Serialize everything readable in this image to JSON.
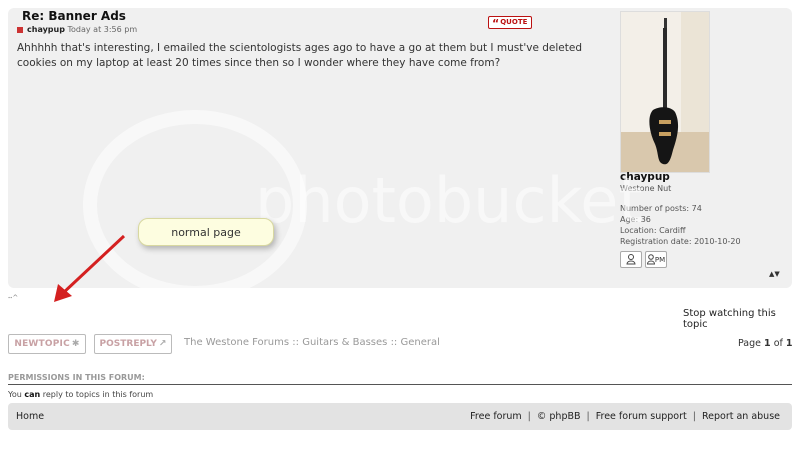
{
  "post": {
    "title": "Re: Banner Ads",
    "author": "chaypup",
    "time": "Today at 3:56 pm",
    "quote_label": "QUOTE",
    "body": "Ahhhhh that's interesting, I emailed the scientologists ages ago to have a go at them but I must've deleted cookies on my laptop at least 20 times since then so I wonder where they have come from?"
  },
  "profile": {
    "name": "chaypup",
    "rank": "Westone Nut",
    "posts": "Number of posts: 74",
    "age": "Age: 36",
    "location": "Location: Cardiff",
    "registered": "Registration date: 2010-10-20",
    "pm_label": "PM",
    "avatar_icon": "bass-guitar-photo"
  },
  "topic": {
    "stop_watching": "Stop watching this topic",
    "new_topic": "NEWTOPIC",
    "post_reply": "POSTREPLY",
    "crumb_1": "The Westone Forums",
    "crumb_2": "Guitars & Basses",
    "crumb_3": "General",
    "crumb_sep": "::",
    "page_prefix": "Page",
    "page_current": "1",
    "page_of": "of",
    "page_total": "1"
  },
  "permissions": {
    "title": "PERMISSIONS IN THIS FORUM:",
    "text_before": "You",
    "text_bold": "can",
    "text_after": "reply to topics in this forum"
  },
  "footer": {
    "home": "Home",
    "free_forum": "Free forum",
    "copyright": "©",
    "phpbb": "phpBB",
    "support": "Free forum support",
    "abuse": "Report an abuse",
    "sep": "|"
  },
  "overlay": {
    "note": "normal page",
    "watermark": "photobucket",
    "arrow_color": "#d42020"
  },
  "colors": {
    "post_bg": "#f0f0f0",
    "footer_bg": "#e3e3e3",
    "quote_red": "#b11111"
  }
}
